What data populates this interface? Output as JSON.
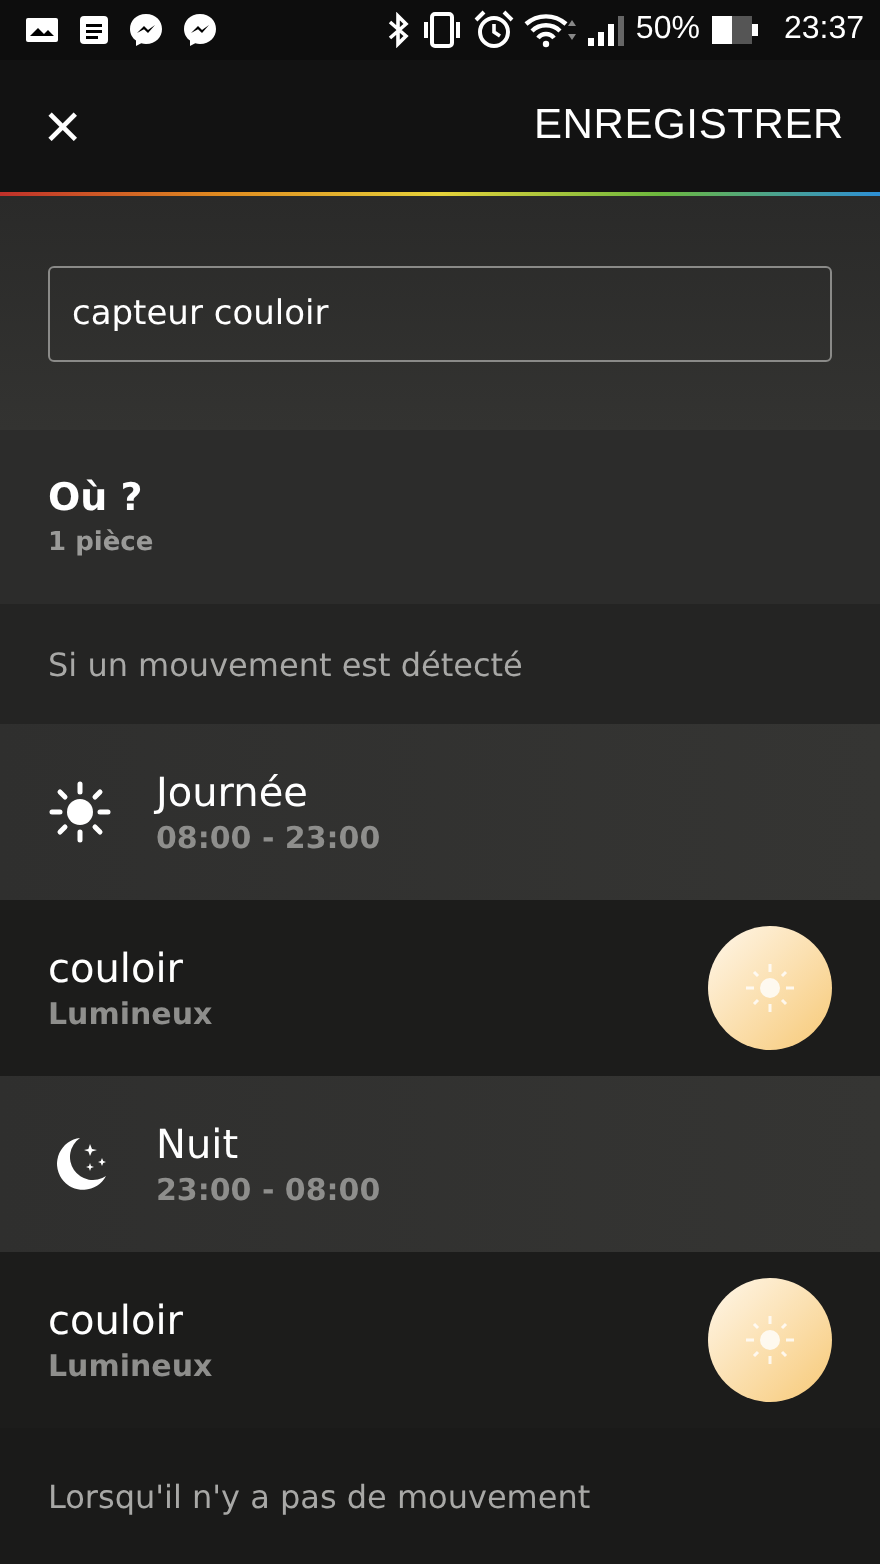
{
  "status_bar": {
    "battery": "50%",
    "time": "23:37"
  },
  "toolbar": {
    "close": "×",
    "save": "ENREGISTRER"
  },
  "name_field": {
    "value": "capteur couloir"
  },
  "room": {
    "title": "Où ?",
    "subtitle": "1 pièce"
  },
  "motion_header": "Si un mouvement est détecté",
  "rows": [
    {
      "kind": "day",
      "title": "Journée",
      "subtitle": "08:00 - 23:00"
    },
    {
      "kind": "light",
      "title": "couloir",
      "subtitle": "Lumineux"
    },
    {
      "kind": "night",
      "title": "Nuit",
      "subtitle": "23:00 - 08:00"
    },
    {
      "kind": "light",
      "title": "couloir",
      "subtitle": "Lumineux"
    }
  ],
  "no_motion_header": "Lorsqu'il n'y a pas de mouvement"
}
